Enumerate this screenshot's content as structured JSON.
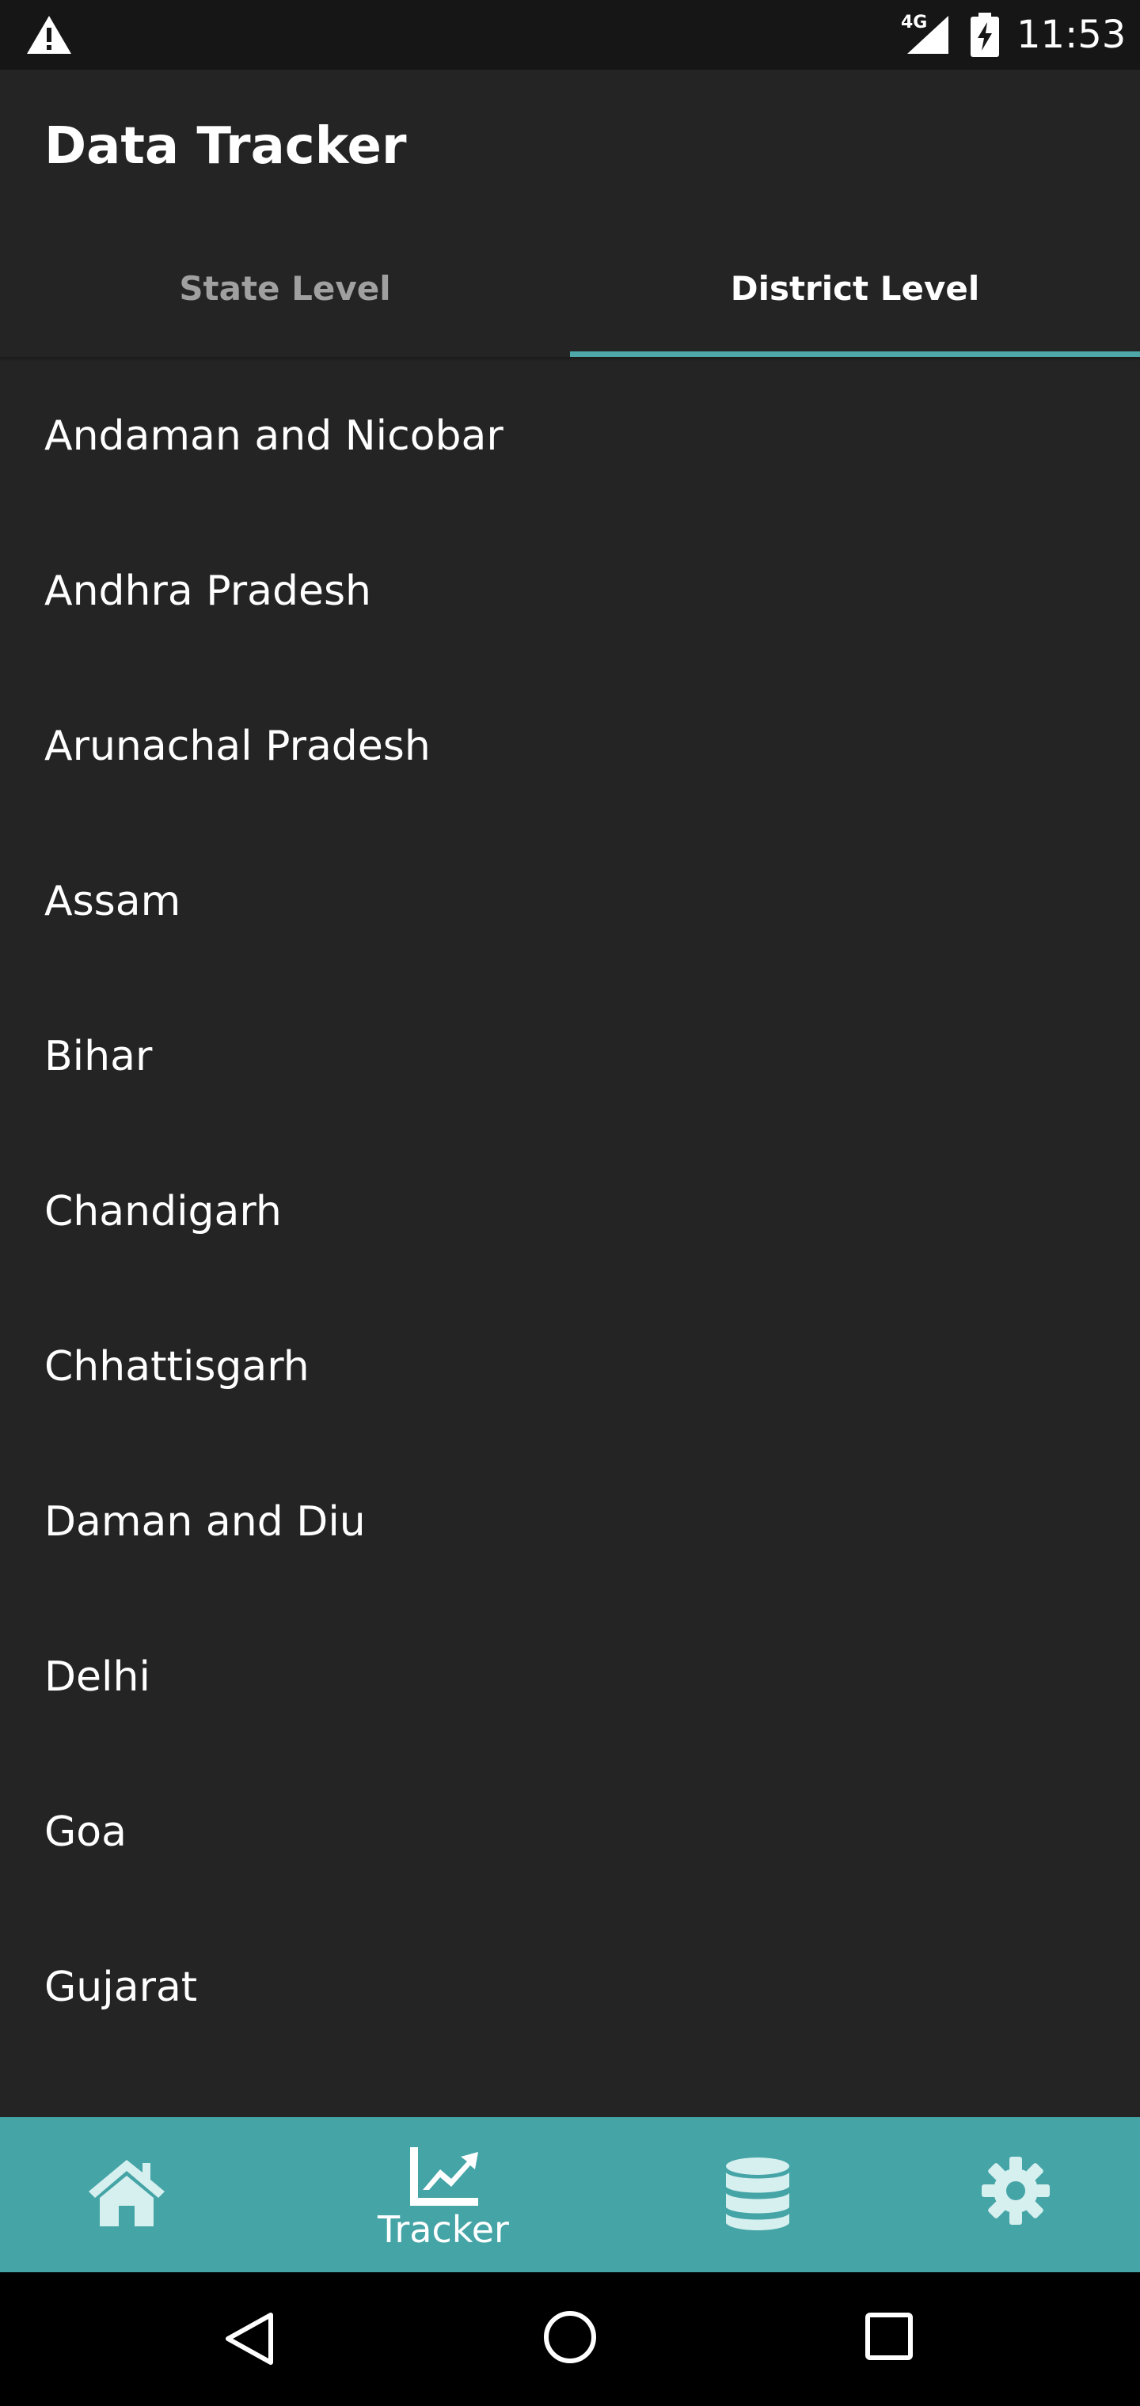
{
  "status_bar": {
    "network": "4G",
    "time": "11:53",
    "icons": [
      "warning-icon",
      "signal-icon",
      "battery-charging-icon"
    ]
  },
  "app_bar": {
    "title": "Data Tracker"
  },
  "tabs": [
    {
      "label": "State Level",
      "selected": false
    },
    {
      "label": "District Level",
      "selected": true
    }
  ],
  "states": [
    "Andaman and Nicobar",
    "Andhra Pradesh",
    "Arunachal Pradesh",
    "Assam",
    "Bihar",
    "Chandigarh",
    "Chhattisgarh",
    "Daman and Diu",
    "Delhi",
    "Goa",
    "Gujarat"
  ],
  "bottom_nav": {
    "items": [
      {
        "icon": "home-icon",
        "label": ""
      },
      {
        "icon": "chart-line-icon",
        "label": "Tracker",
        "selected": true
      },
      {
        "icon": "database-icon",
        "label": ""
      },
      {
        "icon": "gear-icon",
        "label": ""
      }
    ]
  },
  "colors": {
    "background": "#242424",
    "accent": "#44a4a6",
    "tab_indicator": "#4ea8aa",
    "status_bar": "#161616"
  }
}
